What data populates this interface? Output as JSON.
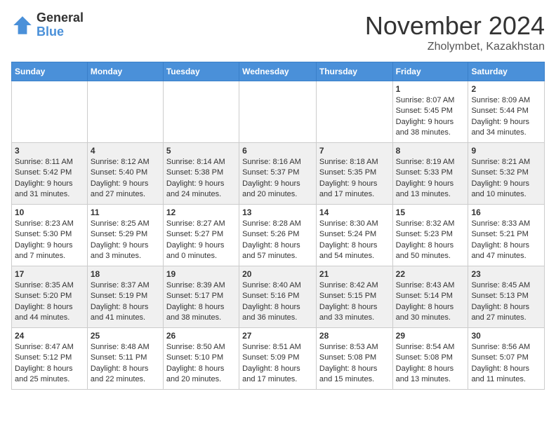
{
  "logo": {
    "general": "General",
    "blue": "Blue"
  },
  "title": "November 2024",
  "location": "Zholymbet, Kazakhstan",
  "weekdays": [
    "Sunday",
    "Monday",
    "Tuesday",
    "Wednesday",
    "Thursday",
    "Friday",
    "Saturday"
  ],
  "weeks": [
    [
      {
        "day": "",
        "info": ""
      },
      {
        "day": "",
        "info": ""
      },
      {
        "day": "",
        "info": ""
      },
      {
        "day": "",
        "info": ""
      },
      {
        "day": "",
        "info": ""
      },
      {
        "day": "1",
        "info": "Sunrise: 8:07 AM\nSunset: 5:45 PM\nDaylight: 9 hours and 38 minutes."
      },
      {
        "day": "2",
        "info": "Sunrise: 8:09 AM\nSunset: 5:44 PM\nDaylight: 9 hours and 34 minutes."
      }
    ],
    [
      {
        "day": "3",
        "info": "Sunrise: 8:11 AM\nSunset: 5:42 PM\nDaylight: 9 hours and 31 minutes."
      },
      {
        "day": "4",
        "info": "Sunrise: 8:12 AM\nSunset: 5:40 PM\nDaylight: 9 hours and 27 minutes."
      },
      {
        "day": "5",
        "info": "Sunrise: 8:14 AM\nSunset: 5:38 PM\nDaylight: 9 hours and 24 minutes."
      },
      {
        "day": "6",
        "info": "Sunrise: 8:16 AM\nSunset: 5:37 PM\nDaylight: 9 hours and 20 minutes."
      },
      {
        "day": "7",
        "info": "Sunrise: 8:18 AM\nSunset: 5:35 PM\nDaylight: 9 hours and 17 minutes."
      },
      {
        "day": "8",
        "info": "Sunrise: 8:19 AM\nSunset: 5:33 PM\nDaylight: 9 hours and 13 minutes."
      },
      {
        "day": "9",
        "info": "Sunrise: 8:21 AM\nSunset: 5:32 PM\nDaylight: 9 hours and 10 minutes."
      }
    ],
    [
      {
        "day": "10",
        "info": "Sunrise: 8:23 AM\nSunset: 5:30 PM\nDaylight: 9 hours and 7 minutes."
      },
      {
        "day": "11",
        "info": "Sunrise: 8:25 AM\nSunset: 5:29 PM\nDaylight: 9 hours and 3 minutes."
      },
      {
        "day": "12",
        "info": "Sunrise: 8:27 AM\nSunset: 5:27 PM\nDaylight: 9 hours and 0 minutes."
      },
      {
        "day": "13",
        "info": "Sunrise: 8:28 AM\nSunset: 5:26 PM\nDaylight: 8 hours and 57 minutes."
      },
      {
        "day": "14",
        "info": "Sunrise: 8:30 AM\nSunset: 5:24 PM\nDaylight: 8 hours and 54 minutes."
      },
      {
        "day": "15",
        "info": "Sunrise: 8:32 AM\nSunset: 5:23 PM\nDaylight: 8 hours and 50 minutes."
      },
      {
        "day": "16",
        "info": "Sunrise: 8:33 AM\nSunset: 5:21 PM\nDaylight: 8 hours and 47 minutes."
      }
    ],
    [
      {
        "day": "17",
        "info": "Sunrise: 8:35 AM\nSunset: 5:20 PM\nDaylight: 8 hours and 44 minutes."
      },
      {
        "day": "18",
        "info": "Sunrise: 8:37 AM\nSunset: 5:19 PM\nDaylight: 8 hours and 41 minutes."
      },
      {
        "day": "19",
        "info": "Sunrise: 8:39 AM\nSunset: 5:17 PM\nDaylight: 8 hours and 38 minutes."
      },
      {
        "day": "20",
        "info": "Sunrise: 8:40 AM\nSunset: 5:16 PM\nDaylight: 8 hours and 36 minutes."
      },
      {
        "day": "21",
        "info": "Sunrise: 8:42 AM\nSunset: 5:15 PM\nDaylight: 8 hours and 33 minutes."
      },
      {
        "day": "22",
        "info": "Sunrise: 8:43 AM\nSunset: 5:14 PM\nDaylight: 8 hours and 30 minutes."
      },
      {
        "day": "23",
        "info": "Sunrise: 8:45 AM\nSunset: 5:13 PM\nDaylight: 8 hours and 27 minutes."
      }
    ],
    [
      {
        "day": "24",
        "info": "Sunrise: 8:47 AM\nSunset: 5:12 PM\nDaylight: 8 hours and 25 minutes."
      },
      {
        "day": "25",
        "info": "Sunrise: 8:48 AM\nSunset: 5:11 PM\nDaylight: 8 hours and 22 minutes."
      },
      {
        "day": "26",
        "info": "Sunrise: 8:50 AM\nSunset: 5:10 PM\nDaylight: 8 hours and 20 minutes."
      },
      {
        "day": "27",
        "info": "Sunrise: 8:51 AM\nSunset: 5:09 PM\nDaylight: 8 hours and 17 minutes."
      },
      {
        "day": "28",
        "info": "Sunrise: 8:53 AM\nSunset: 5:08 PM\nDaylight: 8 hours and 15 minutes."
      },
      {
        "day": "29",
        "info": "Sunrise: 8:54 AM\nSunset: 5:08 PM\nDaylight: 8 hours and 13 minutes."
      },
      {
        "day": "30",
        "info": "Sunrise: 8:56 AM\nSunset: 5:07 PM\nDaylight: 8 hours and 11 minutes."
      }
    ]
  ]
}
